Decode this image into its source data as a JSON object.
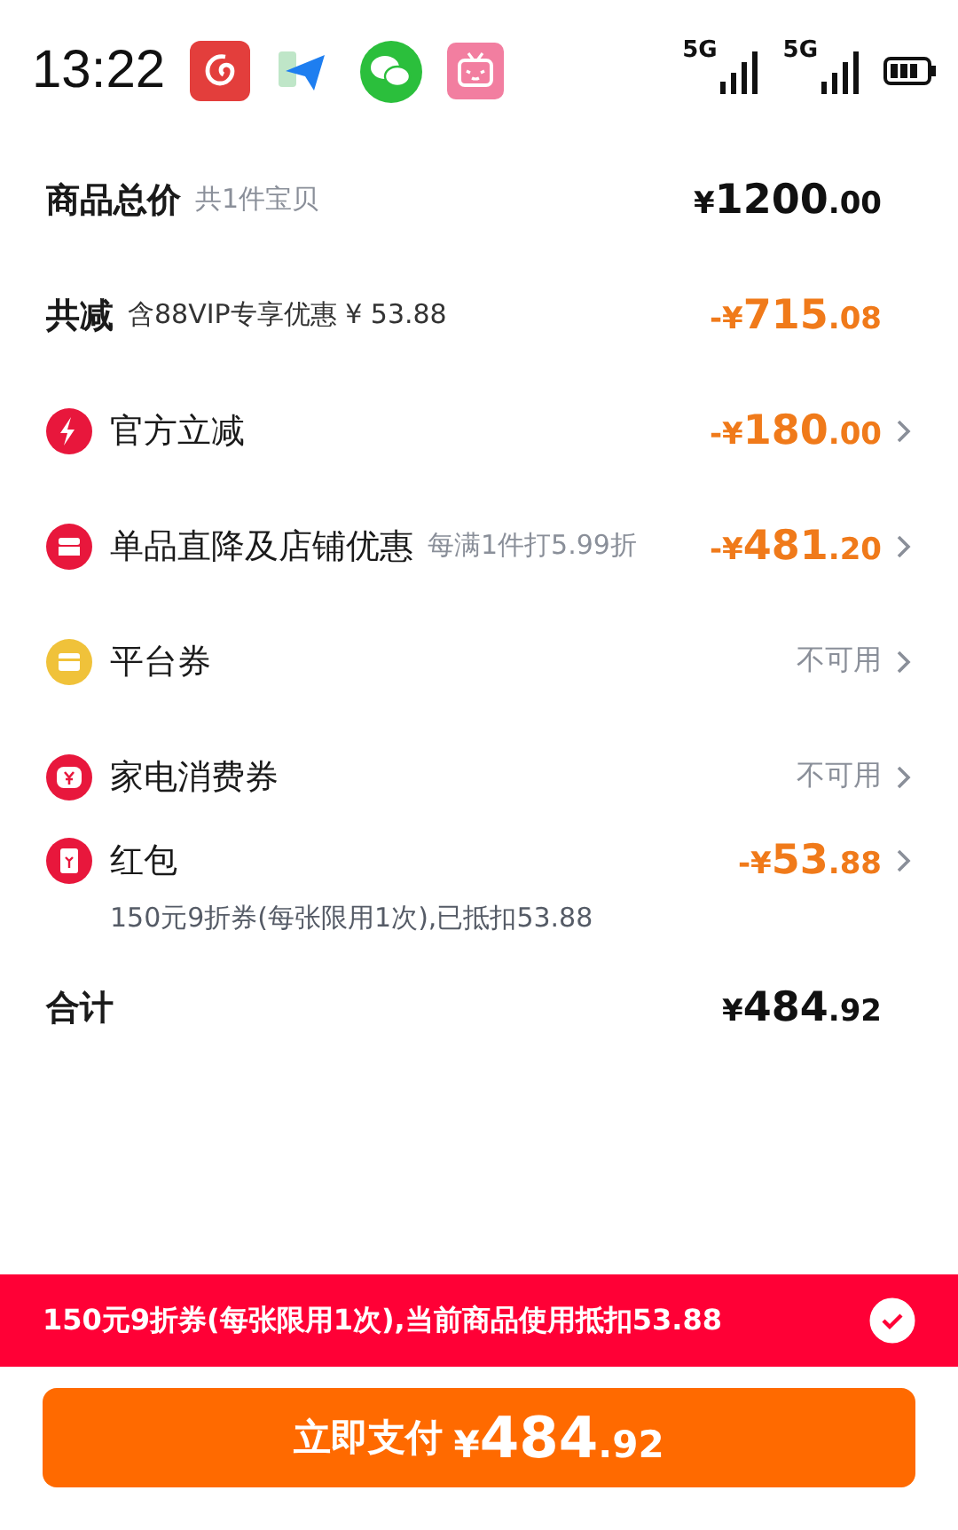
{
  "status_bar": {
    "time": "13:22",
    "apps": [
      {
        "kind": "music"
      },
      {
        "kind": "plane"
      },
      {
        "kind": "chat"
      },
      {
        "kind": "tv"
      }
    ],
    "signals": [
      {
        "label": "5G"
      },
      {
        "label": "5G"
      }
    ]
  },
  "rows": [
    {
      "kind": "summary",
      "label": "商品总价",
      "note": {
        "kind": "muted",
        "text": "共1件宝贝"
      },
      "price": {
        "kind": "amount",
        "sign": "¥",
        "main": "1200",
        "cents": ".00"
      }
    },
    {
      "kind": "summary",
      "label": "共减",
      "note": {
        "kind": "plain",
        "text": "含88VIP专享优惠 ¥ 53.88"
      },
      "price": {
        "kind": "deduction",
        "sign": "-¥",
        "main": "715",
        "cents": ".08"
      }
    },
    {
      "kind": "item",
      "icon": {
        "kind": "bolt",
        "color": "#e8173c"
      },
      "label": "官方立减",
      "price": {
        "kind": "deduction",
        "sign": "-¥",
        "main": "180",
        "cents": ".00"
      }
    },
    {
      "kind": "item",
      "icon": {
        "kind": "shop",
        "color": "#e8173c"
      },
      "label": "单品直降及店铺优惠",
      "note": {
        "kind": "muted",
        "text": "每满1件打5.99折"
      },
      "price": {
        "kind": "deduction",
        "sign": "-¥",
        "main": "481",
        "cents": ".20"
      }
    },
    {
      "kind": "item",
      "icon": {
        "kind": "ticket",
        "color": "#f0c23a"
      },
      "label": "平台券",
      "status": "不可用"
    },
    {
      "kind": "item",
      "icon": {
        "kind": "yen",
        "color": "#e8173c"
      },
      "label": "家电消费券",
      "status": "不可用"
    },
    {
      "kind": "item",
      "icon": {
        "kind": "packet",
        "color": "#e8173c"
      },
      "label": "红包",
      "price": {
        "kind": "deduction",
        "sign": "-¥",
        "main": "53",
        "cents": ".88"
      },
      "detail": "150元9折券(每张限用1次),已抵扣53.88"
    },
    {
      "kind": "summary",
      "label": "合计",
      "price": {
        "kind": "amount",
        "sign": "¥",
        "main": "484",
        "cents": ".92"
      }
    }
  ],
  "banner": {
    "text": "150元9折券(每张限用1次),当前商品使用抵扣53.88",
    "checked": true
  },
  "pay_button": {
    "label": "立即支付",
    "price": {
      "sign": "¥",
      "main": "484",
      "cents": ".92"
    }
  }
}
